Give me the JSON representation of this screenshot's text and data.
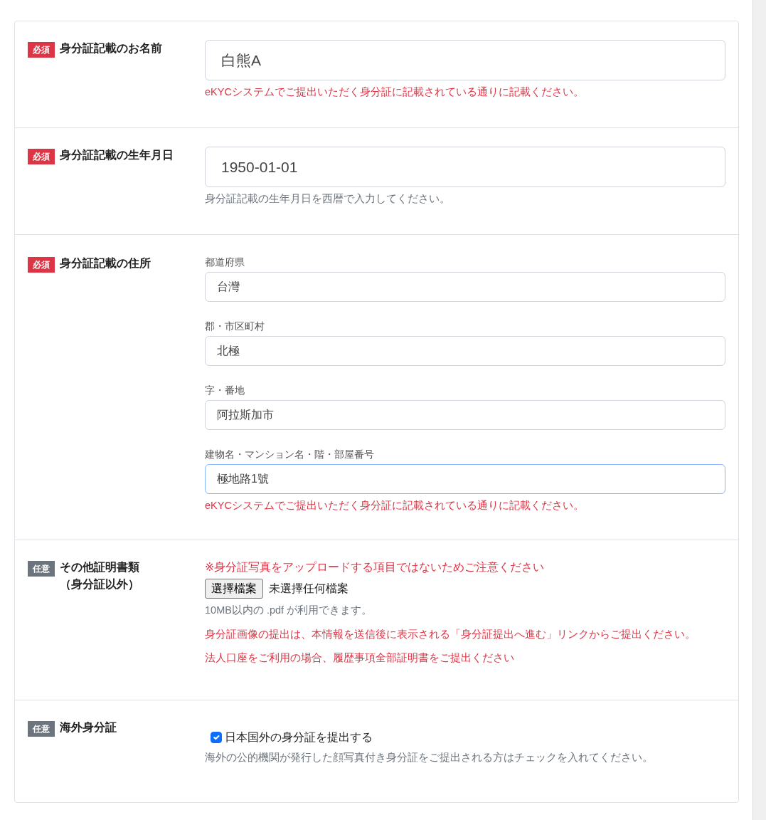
{
  "sections": [
    {
      "kind": "text",
      "badge": {
        "text": "必須",
        "required": true
      },
      "title": [
        "身分証記載のお名前"
      ],
      "inputs": [
        {
          "value": "白熊A",
          "large": true,
          "focused": false
        }
      ],
      "notes": [
        {
          "text": "eKYCシステムでご提出いただく身分証に記載されている通りに記載ください。",
          "color": "#dc3545"
        }
      ]
    },
    {
      "kind": "text",
      "badge": {
        "text": "必須",
        "required": true
      },
      "title": [
        "身分証記載の生年月日"
      ],
      "inputs": [
        {
          "value": "1950-01-01",
          "large": true,
          "focused": false
        }
      ],
      "notes": [
        {
          "text": "身分証記載の生年月日を西暦で入力してください。",
          "color": "#6c757d"
        }
      ]
    },
    {
      "kind": "text",
      "badge": {
        "text": "必須",
        "required": true
      },
      "title": [
        "身分証記載の住所"
      ],
      "inputs": [
        {
          "label": "都道府県",
          "value": "台灣",
          "large": false,
          "focused": false
        },
        {
          "label": "郡・市区町村",
          "value": "北極",
          "large": false,
          "focused": false
        },
        {
          "label": "字・番地",
          "value": "阿拉斯加市",
          "large": false,
          "focused": false
        },
        {
          "label": "建物名・マンション名・階・部屋番号",
          "value": "極地路1號",
          "large": false,
          "focused": true
        }
      ],
      "notes": [
        {
          "text": "eKYCシステムでご提出いただく身分証に記載されている通りに記載ください。",
          "color": "#dc3545"
        }
      ]
    },
    {
      "kind": "file",
      "badge": {
        "text": "任意",
        "required": false
      },
      "title": [
        "その他証明書類",
        "（身分証以外）"
      ],
      "lead": "※身分証写真をアップロードする項目ではないためご注意ください",
      "file": {
        "button": "選擇檔案",
        "status": "未選擇任何檔案"
      },
      "notes": [
        {
          "text": "10MB以内の .pdf が利用できます。",
          "color": "#6c757d"
        },
        {
          "text": "身分証画像の提出は、本情報を送信後に表示される「身分証提出へ進む」リンクからご提出ください。",
          "color": "#dc3545"
        },
        {
          "text": "法人口座をご利用の場合、履歴事項全部証明書をご提出ください",
          "color": "#dc3545"
        }
      ]
    },
    {
      "kind": "checkbox",
      "badge": {
        "text": "任意",
        "required": false
      },
      "title": [
        "海外身分証"
      ],
      "checkbox": {
        "label": "日本国外の身分証を提出する",
        "checked": true
      },
      "notes": [
        {
          "text": "海外の公的機関が発行した顔写真付き身分証をご提出される方はチェックを入れてください。",
          "color": "#6c757d"
        }
      ]
    }
  ]
}
